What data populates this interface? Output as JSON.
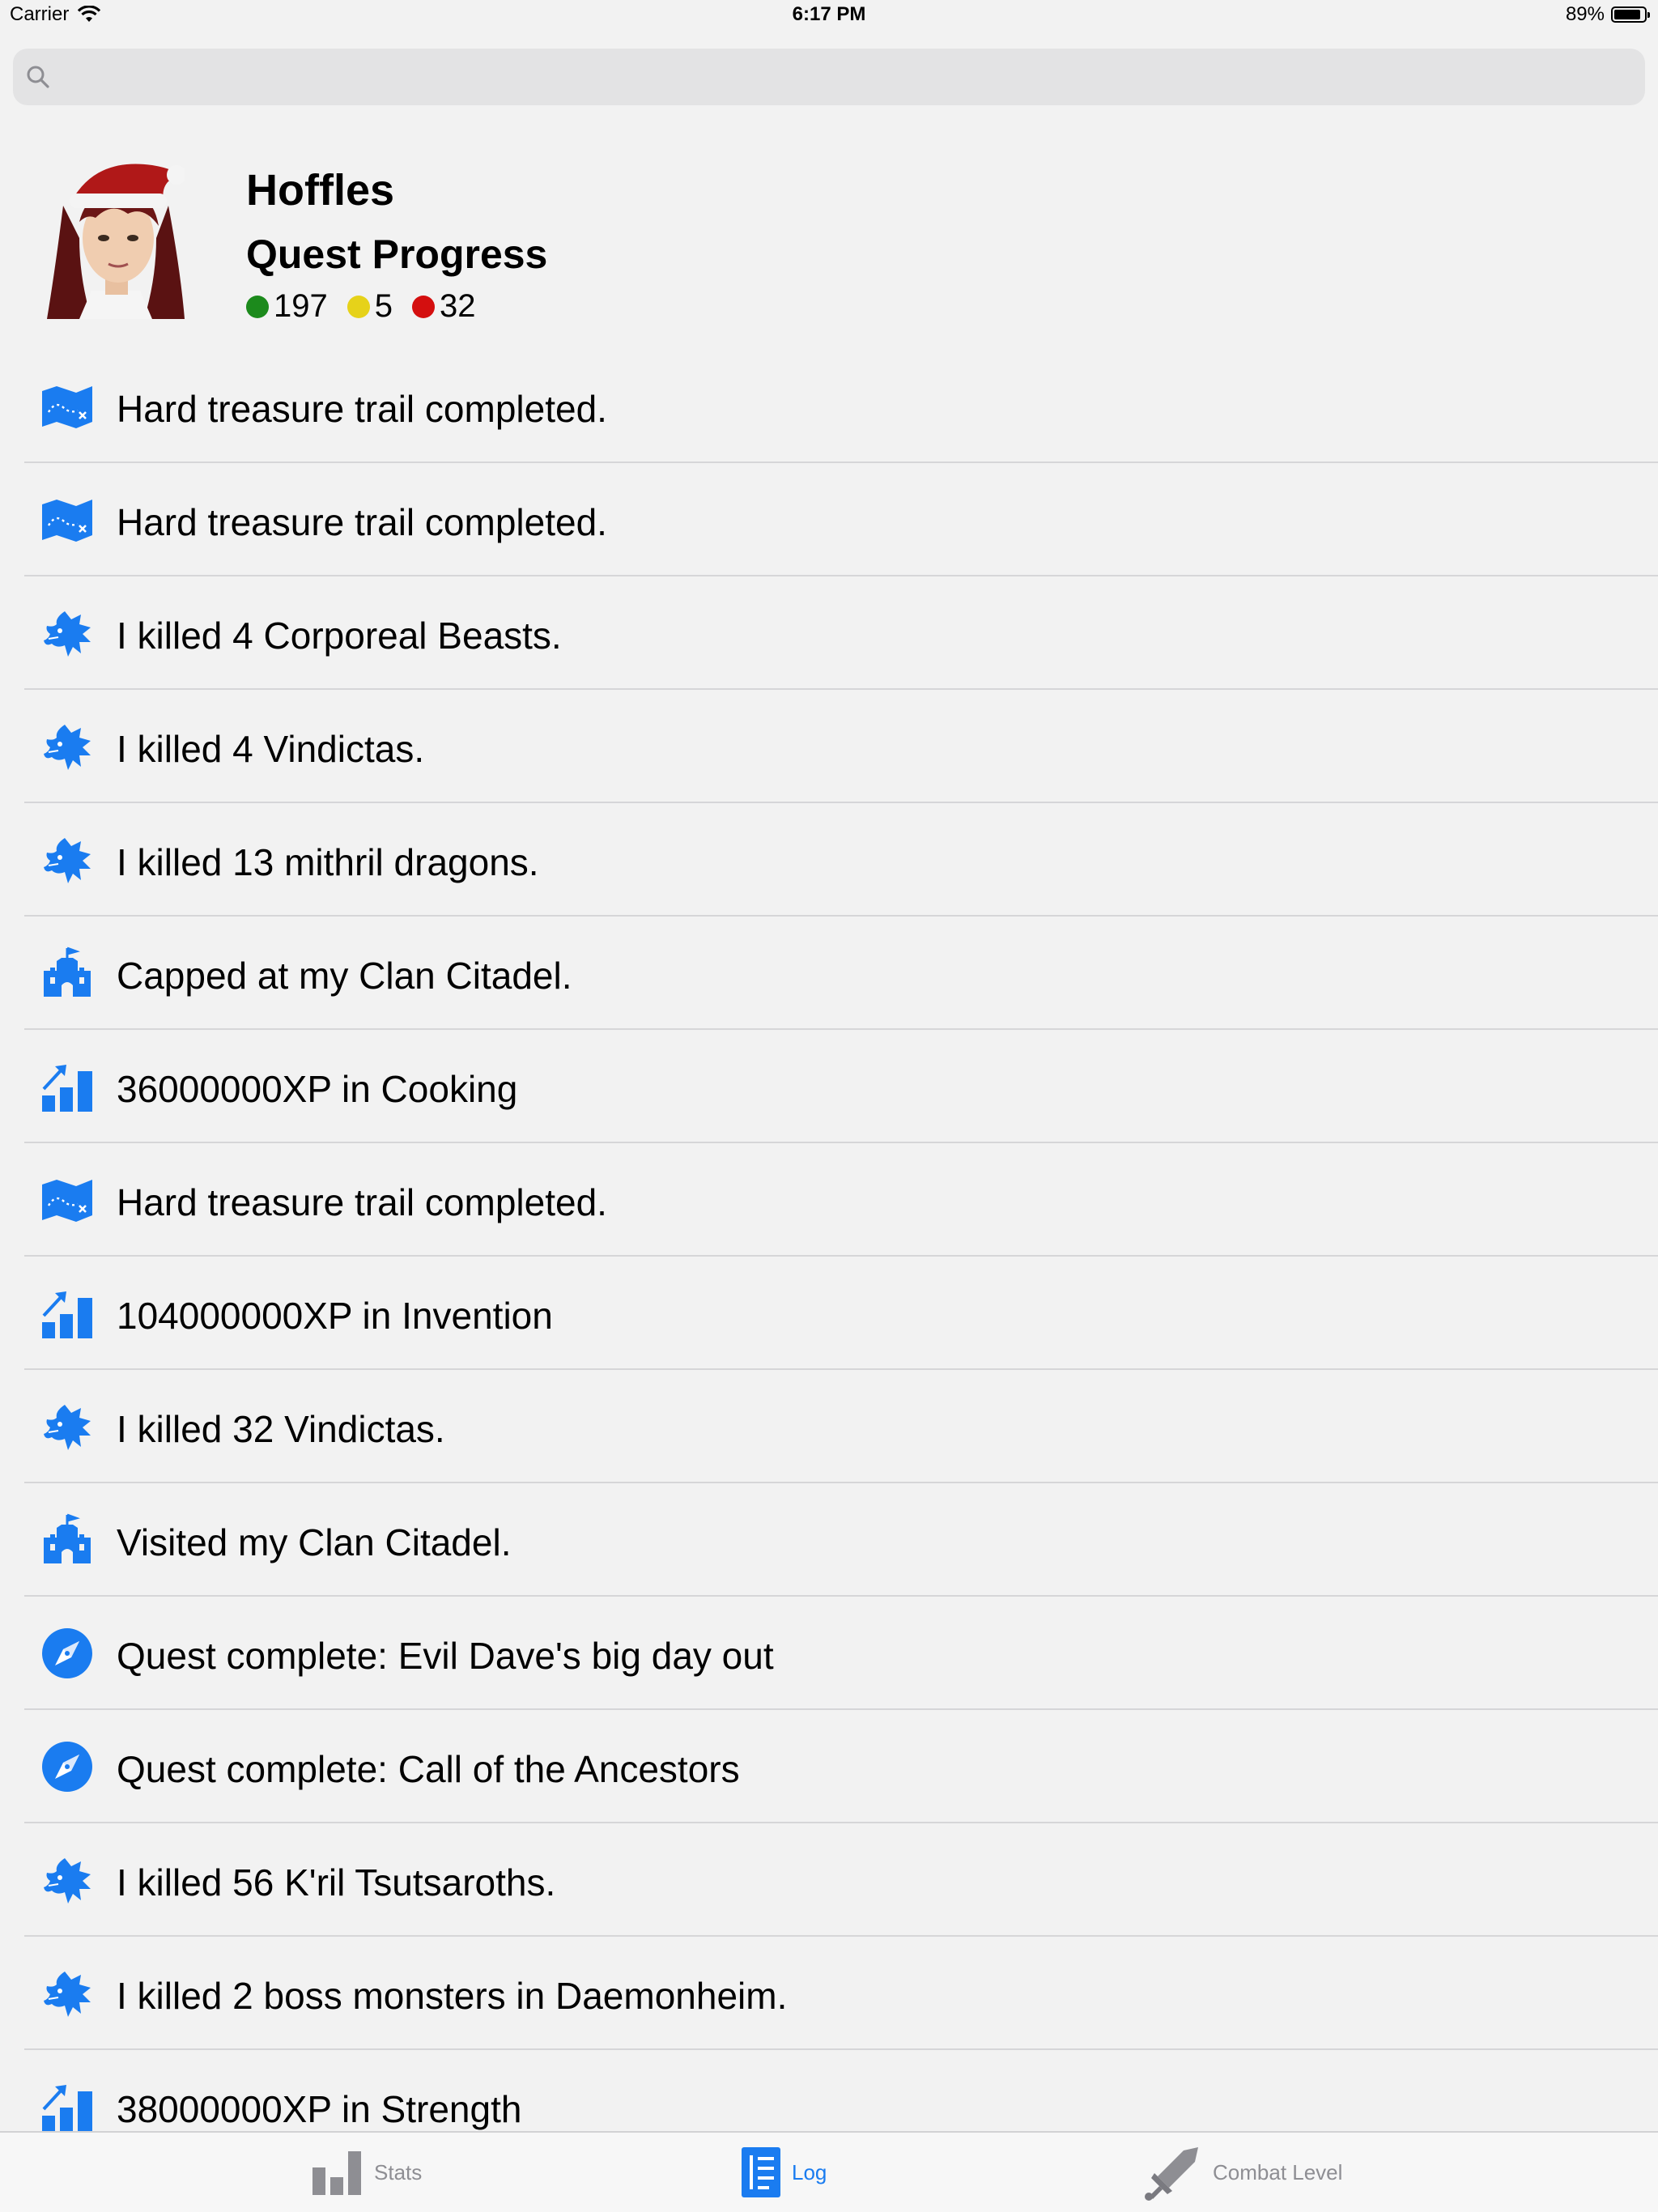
{
  "status_bar": {
    "carrier": "Carrier",
    "time": "6:17 PM",
    "battery": "89%",
    "battery_level": 0.89
  },
  "search": {
    "placeholder": ""
  },
  "profile": {
    "name": "Hoffles",
    "quest_title": "Quest Progress",
    "quests": {
      "completed": "197",
      "started": "5",
      "not_started": "32"
    },
    "colors": {
      "completed": "#1c8a1c",
      "started": "#e6d21a",
      "not_started": "#d40f0f"
    }
  },
  "log": [
    {
      "icon": "treasure-map-icon",
      "text": "Hard treasure trail completed."
    },
    {
      "icon": "treasure-map-icon",
      "text": "Hard treasure trail completed."
    },
    {
      "icon": "dragon-icon",
      "text": "I killed 4 Corporeal Beasts."
    },
    {
      "icon": "dragon-icon",
      "text": "I killed 4 Vindictas."
    },
    {
      "icon": "dragon-icon",
      "text": "I killed 13 mithril dragons."
    },
    {
      "icon": "castle-icon",
      "text": "Capped at my Clan Citadel."
    },
    {
      "icon": "xp-chart-icon",
      "text": "36000000XP in Cooking"
    },
    {
      "icon": "treasure-map-icon",
      "text": "Hard treasure trail completed."
    },
    {
      "icon": "xp-chart-icon",
      "text": "104000000XP in Invention"
    },
    {
      "icon": "dragon-icon",
      "text": "I killed 32 Vindictas."
    },
    {
      "icon": "castle-icon",
      "text": "Visited my Clan Citadel."
    },
    {
      "icon": "compass-icon",
      "text": "Quest complete: Evil Dave's big day out"
    },
    {
      "icon": "compass-icon",
      "text": "Quest complete: Call of the Ancestors"
    },
    {
      "icon": "dragon-icon",
      "text": "I killed 56 K'ril Tsutsaroths."
    },
    {
      "icon": "dragon-icon",
      "text": "I killed 2 boss monsters in Daemonheim."
    },
    {
      "icon": "xp-chart-icon",
      "text": "38000000XP in Strength"
    }
  ],
  "tabs": [
    {
      "label": "Stats",
      "icon": "bar-chart-icon",
      "active": false
    },
    {
      "label": "Log",
      "icon": "log-list-icon",
      "active": true
    },
    {
      "label": "Combat Level",
      "icon": "sword-icon",
      "active": false
    }
  ],
  "colors": {
    "accent": "#1a7cf0",
    "background": "#f2f2f2",
    "inactive": "#8e8e93"
  }
}
